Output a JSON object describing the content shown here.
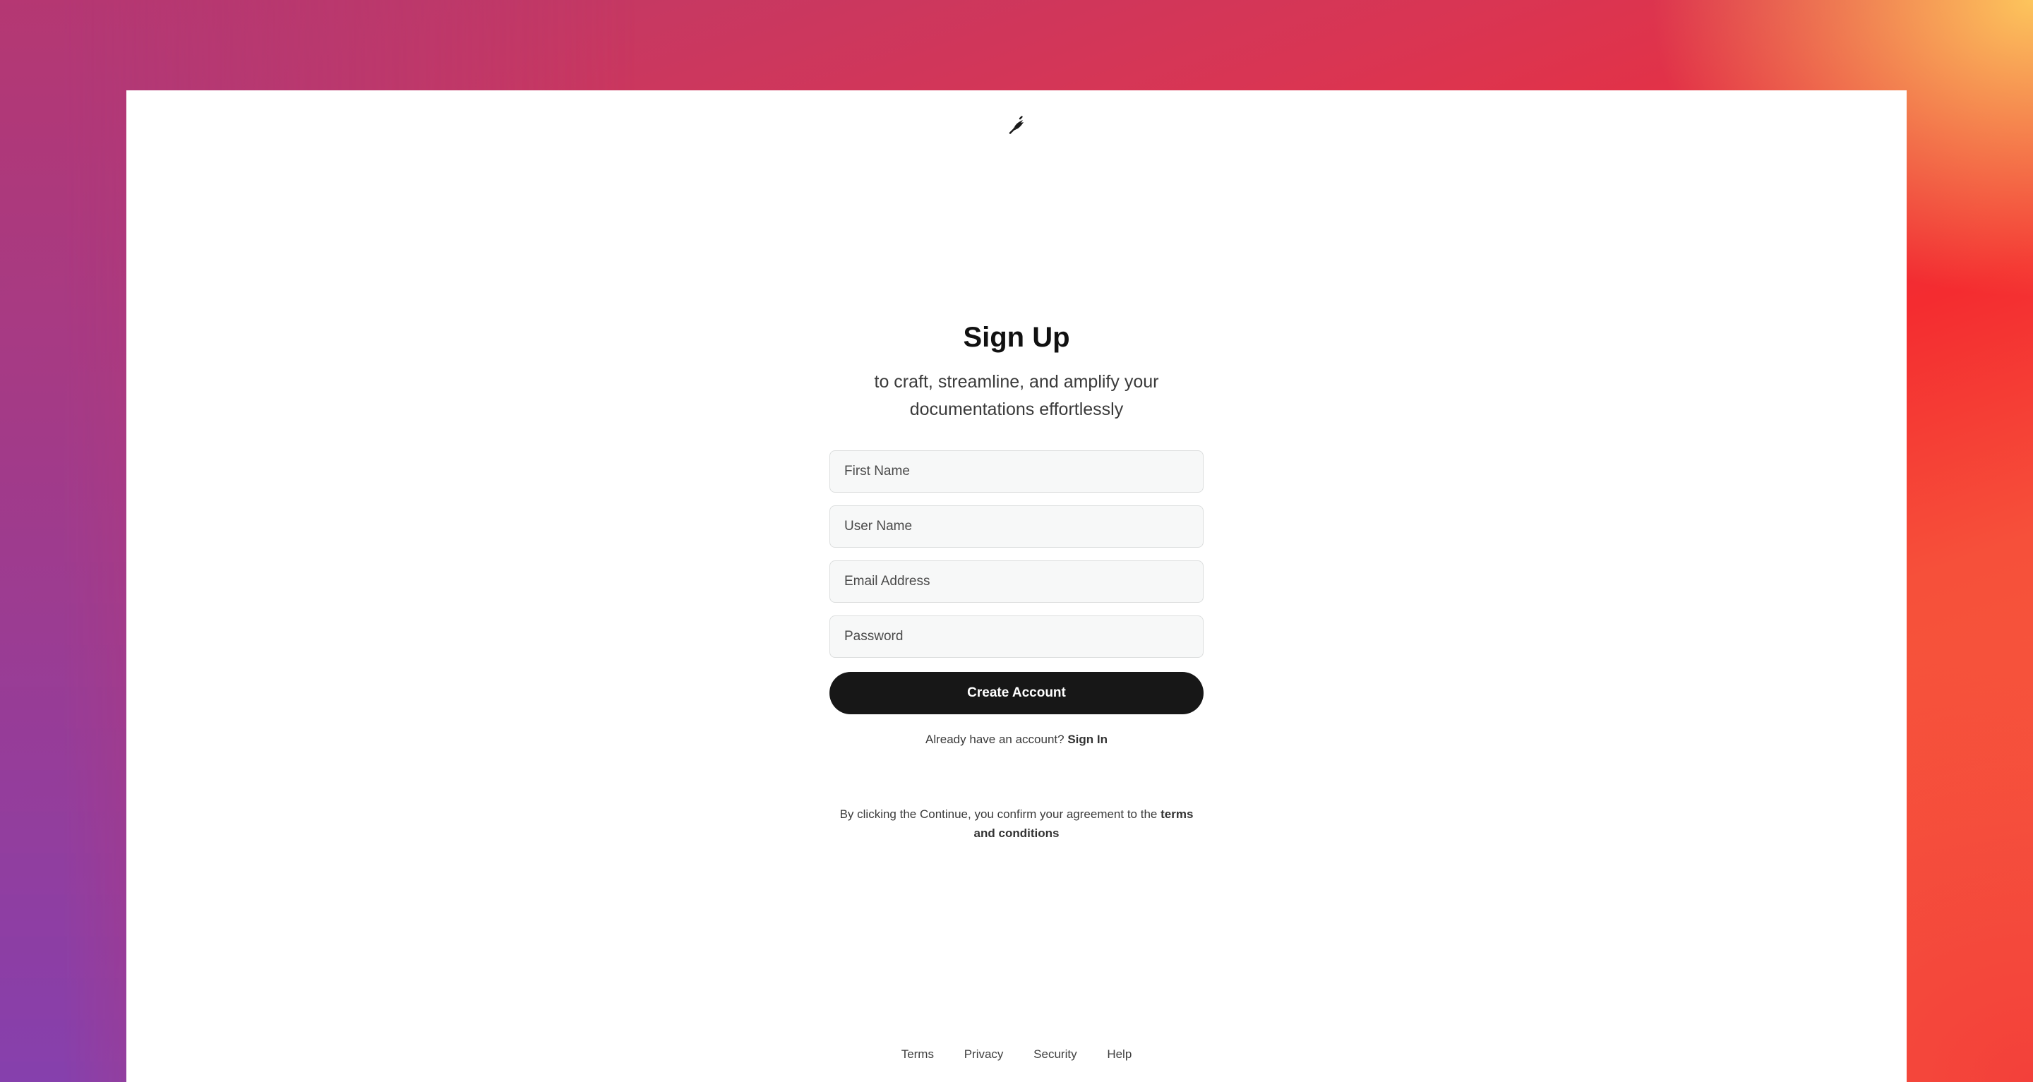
{
  "brand": {
    "logo_icon": "feather-pen-icon",
    "colors": {
      "primary_button": "#171717",
      "field_background": "#f7f8f8",
      "field_border": "#dcdede",
      "background_gradient": [
        "#b83a6e",
        "#f42c30",
        "#fdc55c",
        "#8640ad"
      ]
    }
  },
  "signup": {
    "title": "Sign Up",
    "subtitle": "to craft, streamline, and amplify your documentations effortlessly",
    "fields": {
      "first_name": {
        "placeholder": "First Name",
        "value": ""
      },
      "user_name": {
        "placeholder": "User Name",
        "value": ""
      },
      "email": {
        "placeholder": "Email Address",
        "value": ""
      },
      "password": {
        "placeholder": "Password",
        "value": ""
      }
    },
    "create_button_label": "Create Account",
    "signin_prompt": "Already have an account?",
    "signin_link": "Sign In",
    "terms_prefix": "By clicking the Continue, you confirm your agreement to the",
    "terms_link": "terms and conditions"
  },
  "footer": {
    "links": [
      "Terms",
      "Privacy",
      "Security",
      "Help"
    ]
  }
}
